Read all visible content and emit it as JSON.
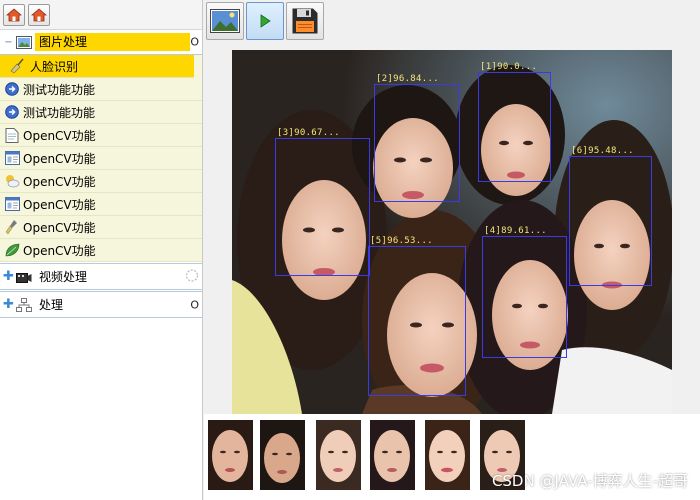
{
  "sidebar": {
    "sections": [
      {
        "label": "图片处理",
        "end_marker": "O",
        "items": [
          {
            "label": "人脸识别",
            "icon": "broom-icon",
            "selected": true
          },
          {
            "label": "测试功能功能",
            "icon": "circle-arrow-icon"
          },
          {
            "label": "测试功能功能",
            "icon": "circle-arrow-icon"
          },
          {
            "label": "OpenCV功能",
            "icon": "document-icon"
          },
          {
            "label": "OpenCV功能",
            "icon": "window-tile-icon"
          },
          {
            "label": "OpenCV功能",
            "icon": "weather-cloud-icon"
          },
          {
            "label": "OpenCV功能",
            "icon": "window-tile-icon"
          },
          {
            "label": "OpenCV功能",
            "icon": "brush-icon"
          },
          {
            "label": "OpenCV功能",
            "icon": "leaf-icon"
          }
        ]
      },
      {
        "label": "视频处理",
        "end_marker": "",
        "icon": "film-icon"
      },
      {
        "label": "处理",
        "end_marker": "O",
        "icon": "network-icon"
      }
    ]
  },
  "faces": [
    {
      "label": "[2]96.84..."
    },
    {
      "label": "[1]90.0..."
    },
    {
      "label": "[3]90.67..."
    },
    {
      "label": "[6]95.48..."
    },
    {
      "label": "[5]96.53..."
    },
    {
      "label": "[4]89.61..."
    }
  ],
  "watermark": "CSDN @JAVA-博弈人生-超哥",
  "colors": {
    "selection": "#ffd700",
    "item_background": "#f6f6dc",
    "face_box": "#3a3ae6",
    "face_label": "#f4e77a"
  }
}
